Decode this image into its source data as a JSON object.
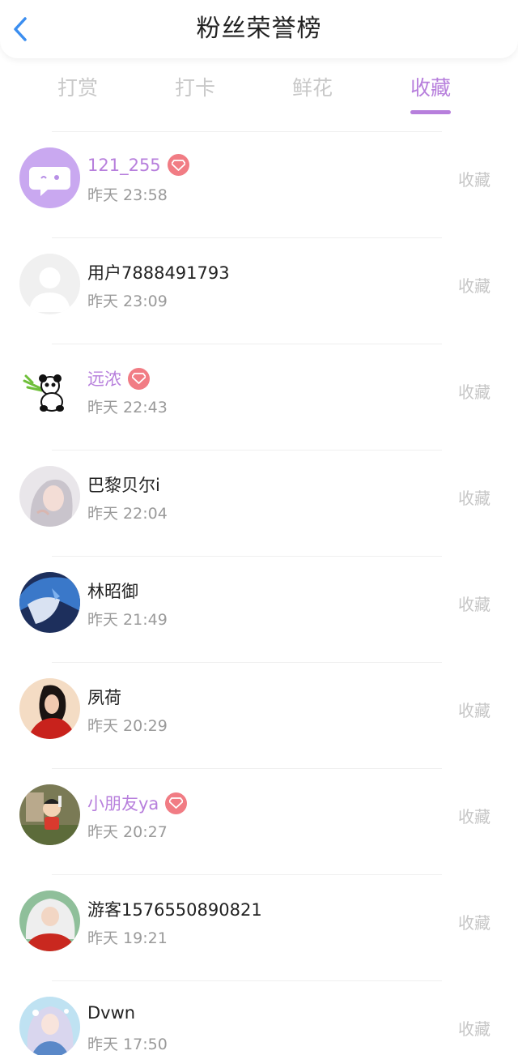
{
  "header": {
    "title": "粉丝荣誉榜"
  },
  "tabs": [
    {
      "label": "打赏",
      "active": false
    },
    {
      "label": "打卡",
      "active": false
    },
    {
      "label": "鲜花",
      "active": false
    },
    {
      "label": "收藏",
      "active": true
    }
  ],
  "colors": {
    "accent": "#b77fdc",
    "badge": "#f17c84",
    "back_arrow": "#3b8ef0"
  },
  "fans": [
    {
      "name": "121_255",
      "time": "昨天 23:58",
      "action": "收藏",
      "vip": true,
      "avatar": "chat-bubble-avatar"
    },
    {
      "name": "用户7888491793",
      "time": "昨天 23:09",
      "action": "收藏",
      "vip": false,
      "avatar": "default-user-avatar"
    },
    {
      "name": "远浓",
      "time": "昨天 22:43",
      "action": "收藏",
      "vip": true,
      "avatar": "panda-avatar"
    },
    {
      "name": "巴黎贝尔i",
      "time": "昨天 22:04",
      "action": "收藏",
      "vip": false,
      "avatar": "anime-girl-grey-hair-avatar"
    },
    {
      "name": "林昭御",
      "time": "昨天 21:49",
      "action": "收藏",
      "vip": false,
      "avatar": "anime-blue-hair-avatar"
    },
    {
      "name": "夙荷",
      "time": "昨天 20:29",
      "action": "收藏",
      "vip": false,
      "avatar": "girl-red-dress-avatar"
    },
    {
      "name": "小朋友ya",
      "time": "昨天 20:27",
      "action": "收藏",
      "vip": true,
      "avatar": "cartoon-boy-avatar"
    },
    {
      "name": "游客1576550890821",
      "time": "昨天 19:21",
      "action": "收藏",
      "vip": false,
      "avatar": "anime-white-hair-red-avatar"
    },
    {
      "name": "Dvwn",
      "time": "昨天 17:50",
      "action": "收藏",
      "vip": false,
      "avatar": "anime-girl-blue-avatar"
    }
  ]
}
